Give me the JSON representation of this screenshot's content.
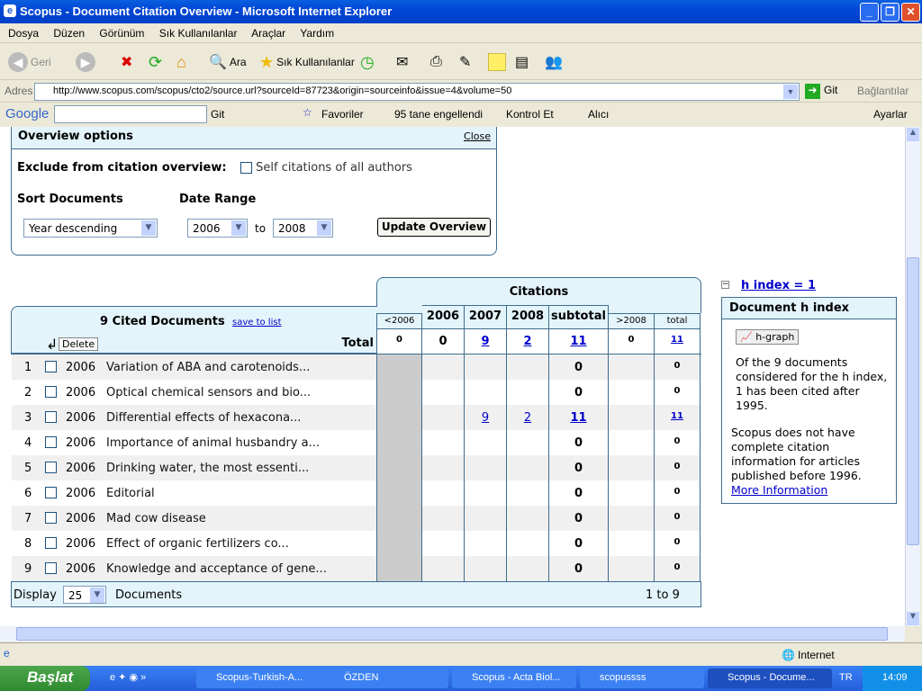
{
  "window": {
    "title": "Scopus - Document Citation Overview - Microsoft Internet Explorer"
  },
  "menu": [
    "Dosya",
    "Düzen",
    "Görünüm",
    "Sık Kullanılanlar",
    "Araçlar",
    "Yardım"
  ],
  "toolbar": {
    "back": "Geri",
    "search": "Ara",
    "favorites": "Sık Kullanılanlar"
  },
  "address": {
    "label": "Adres",
    "url": "http://www.scopus.com/scopus/cto2/source.url?sourceId=87723&origin=sourceinfo&issue=4&volume=50",
    "go": "Git",
    "links": "Bağlantılar"
  },
  "google": {
    "logo": "Google",
    "go": "Git",
    "favorites": "Favoriler",
    "blocked": "95 tane engellendi",
    "check": "Kontrol Et",
    "send": "Alıcı",
    "settings": "Ayarlar"
  },
  "options": {
    "title": "Overview options",
    "close": "Close",
    "exclude_label": "Exclude from citation overview:",
    "self_citations": "Self citations of all authors",
    "sort_label": "Sort Documents",
    "sort_value": "Year descending",
    "date_label": "Date Range",
    "from": "2006",
    "to_label": "to",
    "to": "2008",
    "update": "Update Overview"
  },
  "table": {
    "citations_label": "Citations",
    "cited_docs": "9 Cited Documents",
    "save_to_list": "save to list",
    "delete": "Delete",
    "total_label": "Total",
    "columns": [
      "<2006",
      "2006",
      "2007",
      "2008",
      "subtotal",
      ">2008",
      "total"
    ],
    "totals": [
      "0",
      "0",
      "9",
      "2",
      "11",
      "0",
      "11"
    ],
    "rows": [
      {
        "n": "1",
        "year": "2006",
        "title": "Variation of ABA and carotenoids...",
        "cells": [
          "",
          "",
          "",
          "",
          "0",
          "",
          "0"
        ]
      },
      {
        "n": "2",
        "year": "2006",
        "title": "Optical chemical sensors and bio...",
        "cells": [
          "",
          "",
          "",
          "",
          "0",
          "",
          "0"
        ]
      },
      {
        "n": "3",
        "year": "2006",
        "title": "Differential effects of hexacona...",
        "cells": [
          "",
          "",
          "9",
          "2",
          "11",
          "",
          "11"
        ]
      },
      {
        "n": "4",
        "year": "2006",
        "title": "Importance of animal husbandry a...",
        "cells": [
          "",
          "",
          "",
          "",
          "0",
          "",
          "0"
        ]
      },
      {
        "n": "5",
        "year": "2006",
        "title": "Drinking water, the most essenti...",
        "cells": [
          "",
          "",
          "",
          "",
          "0",
          "",
          "0"
        ]
      },
      {
        "n": "6",
        "year": "2006",
        "title": "Editorial",
        "cells": [
          "",
          "",
          "",
          "",
          "0",
          "",
          "0"
        ]
      },
      {
        "n": "7",
        "year": "2006",
        "title": "Mad cow disease",
        "cells": [
          "",
          "",
          "",
          "",
          "0",
          "",
          "0"
        ]
      },
      {
        "n": "8",
        "year": "2006",
        "title": "Effect of organic fertilizers co...",
        "cells": [
          "",
          "",
          "",
          "",
          "0",
          "",
          "0"
        ]
      },
      {
        "n": "9",
        "year": "2006",
        "title": "Knowledge and acceptance of gene...",
        "cells": [
          "",
          "",
          "",
          "",
          "0",
          "",
          "0"
        ]
      }
    ],
    "display_label": "Display",
    "display_value": "25",
    "documents_label": "Documents",
    "range": "1 to 9"
  },
  "hindex": {
    "link": "h index = 1",
    "title": "Document h index",
    "graph_btn": "h-graph",
    "text1": "Of the 9 documents considered for the h index, 1 has been cited after 1995.",
    "text2": "Scopus does not have complete citation information for articles published before 1996.",
    "more": "More Information"
  },
  "status": {
    "zone": "Internet"
  },
  "taskbar": {
    "start": "Başlat",
    "tasks": [
      "Scopus-Turkish-A...",
      "ÖZDEN",
      "Scopus - Acta Biol...",
      "scopussss",
      "Scopus - Docume..."
    ],
    "lang": "TR",
    "clock": "14:09"
  },
  "colors": {
    "header_bg": "#e3f4fb",
    "border": "#3f6c8f",
    "link": "#0000cc"
  }
}
